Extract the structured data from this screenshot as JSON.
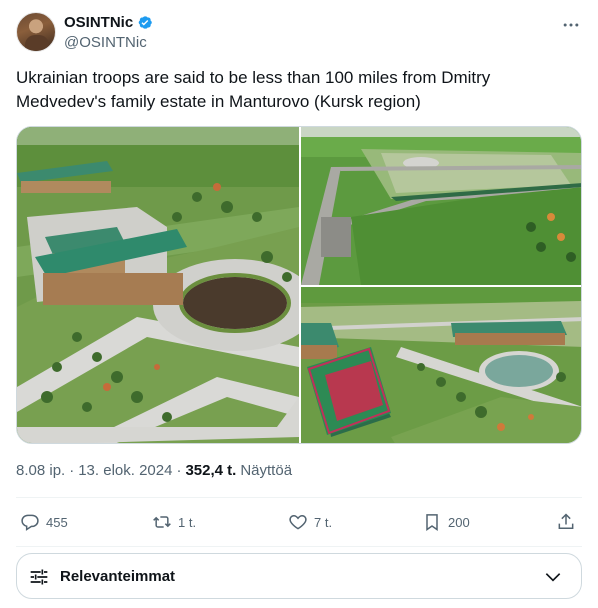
{
  "author": {
    "display_name": "OSINTNic",
    "handle": "@OSINTNic",
    "verified": true,
    "verified_color": "#1d9bf0"
  },
  "tweet": {
    "text": "Ukrainian troops are said to be less than 100 miles from Dmitry Medvedev's family estate in Manturovo (Kursk region)"
  },
  "media": {
    "count": 3,
    "items": [
      "estate-aerial-mansion",
      "estate-aerial-overview",
      "estate-aerial-pond-sports-court"
    ]
  },
  "meta": {
    "time": "8.08 ip.",
    "separator1": "·",
    "date": "13. elok. 2024",
    "separator2": "·",
    "views": "352,4 t.",
    "views_label": "Näyttöä"
  },
  "actions": {
    "replies": "455",
    "reposts": "1 t.",
    "likes": "7 t.",
    "bookmarks": "200"
  },
  "sort": {
    "label": "Relevanteimmat"
  },
  "icons": {
    "more": "more-horizontal-icon",
    "reply": "reply-icon",
    "repost": "repost-icon",
    "like": "heart-icon",
    "bookmark": "bookmark-icon",
    "share": "share-icon",
    "sort": "sliders-icon",
    "chevron": "chevron-down-icon"
  }
}
